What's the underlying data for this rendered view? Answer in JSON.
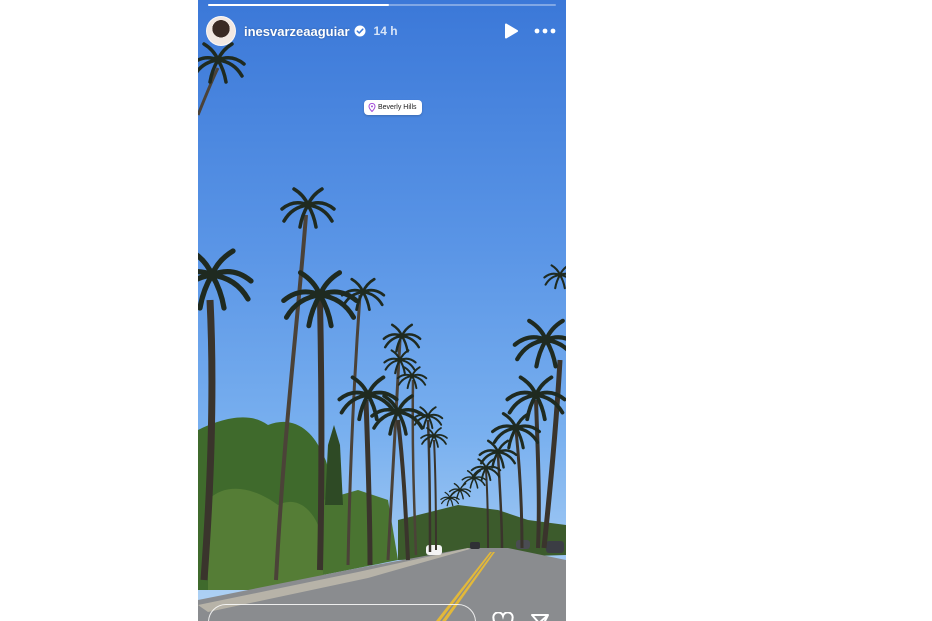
{
  "story": {
    "username": "inesvarzeaaguiar",
    "time_ago": "14 h",
    "location": "Beverly Hills",
    "progress": 0.52
  },
  "icons": {
    "verified": "verified-badge-icon",
    "play": "play-icon",
    "more": "more-horizontal-icon",
    "location_pin": "location-pin-icon",
    "like": "heart-icon",
    "share": "share-icon"
  }
}
